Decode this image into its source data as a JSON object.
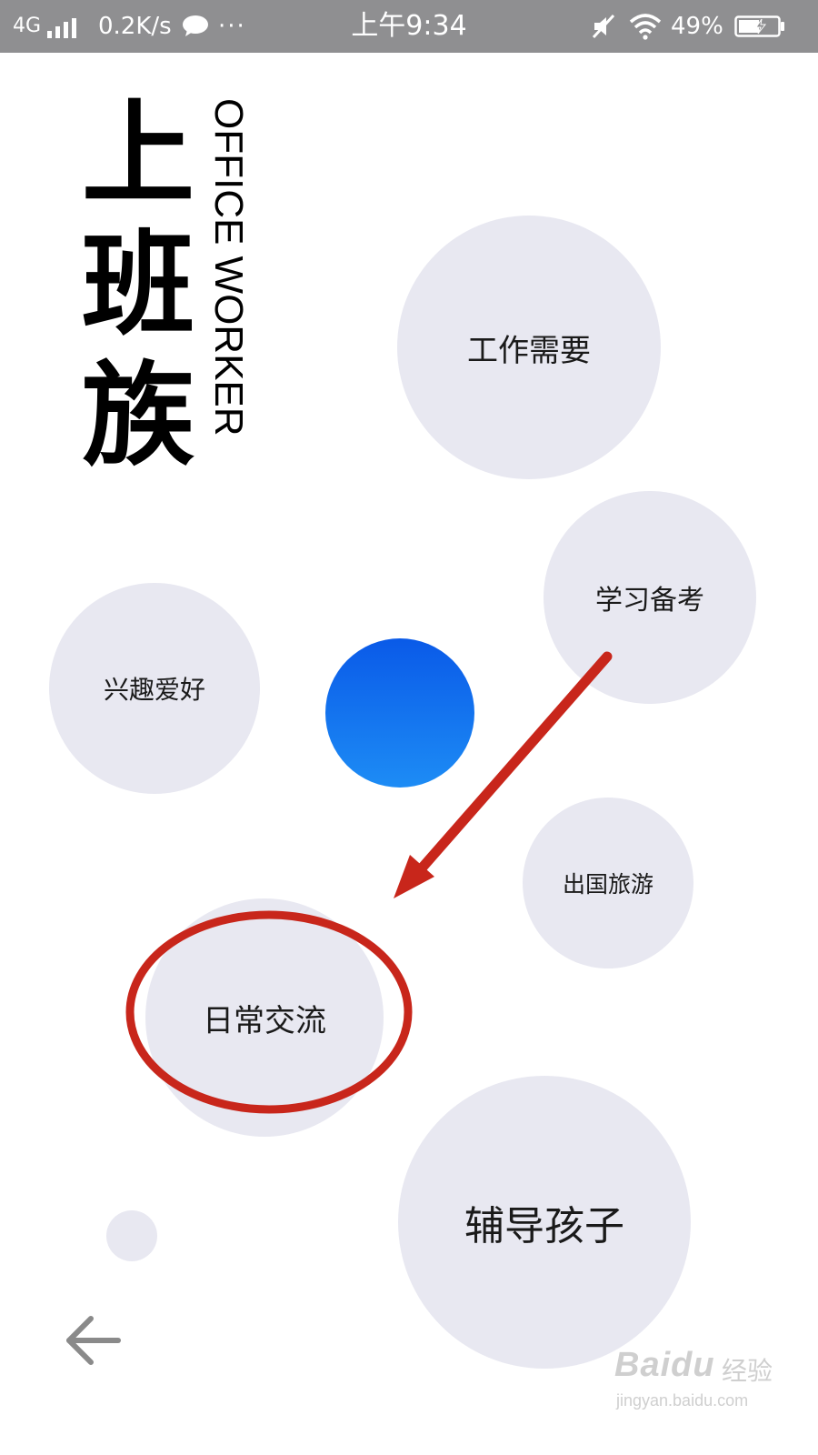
{
  "status_bar": {
    "network": "4G",
    "speed": "0.2K/s",
    "more": "···",
    "time": "上午9:34",
    "battery": "49%",
    "icons": [
      "signal-icon",
      "chat-bubble-icon",
      "mute-icon",
      "wifi-icon",
      "battery-icon"
    ]
  },
  "title": {
    "chinese_chars": [
      "上",
      "班",
      "族"
    ],
    "english": "OFFICE WORKER"
  },
  "bubbles": {
    "work": "工作需要",
    "study": "学习备考",
    "hobby": "兴趣爱好",
    "travel": "出国旅游",
    "daily": "日常交流",
    "kids": "辅导孩子"
  },
  "watermark": {
    "logo": "Baidu",
    "label": "经验",
    "url": "jingyan.baidu.com"
  },
  "colors": {
    "status_bar": "#8f8f91",
    "bubble": "#e8e8f1",
    "blue_dot_top": "#0a5ae8",
    "blue_dot_bottom": "#1d8cf5",
    "annotation_red": "#c8261b"
  }
}
